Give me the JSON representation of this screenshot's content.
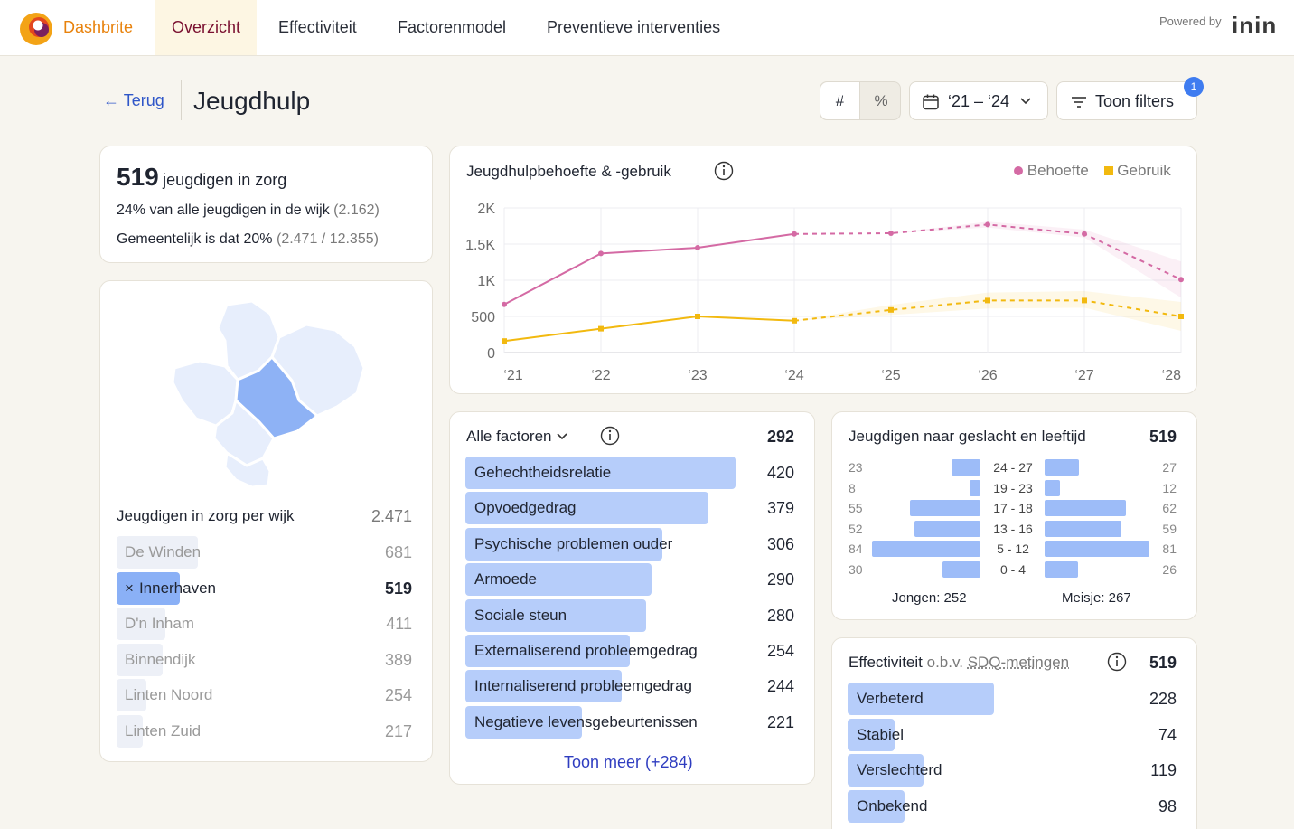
{
  "app": {
    "brand": "Dashbrite",
    "powered_by": "Powered by",
    "partner": "inin"
  },
  "nav": [
    {
      "label": "Overzicht",
      "active": true
    },
    {
      "label": "Effectiviteit",
      "active": false
    },
    {
      "label": "Factorenmodel",
      "active": false
    },
    {
      "label": "Preventieve interventies",
      "active": false
    }
  ],
  "header": {
    "back_label": "Terug",
    "title": "Jeugdhulp",
    "toggle": [
      "#",
      "%"
    ],
    "date_range": "‘21 – ‘24",
    "filters_label": "Toon filters",
    "filters_count": "1"
  },
  "summary": {
    "count": "519",
    "count_label": "jeugdigen in zorg",
    "line1_text": "24% van alle jeugdigen in de wijk",
    "line1_muted": "(2.162)",
    "line2_text": "Gemeentelijk is dat 20%",
    "line2_muted": "(2.471 / 12.355)"
  },
  "wijk": {
    "title": "Jeugdigen in zorg per wijk",
    "total": "2.471",
    "items": [
      {
        "label": "De Winden",
        "value": "681",
        "fraction": 1.0,
        "selected": false
      },
      {
        "label": "Innerhaven",
        "value": "519",
        "fraction": 0.76,
        "selected": true,
        "remove_glyph": "×"
      },
      {
        "label": "D'n Inham",
        "value": "411",
        "fraction": 0.6,
        "selected": false
      },
      {
        "label": "Binnendijk",
        "value": "389",
        "fraction": 0.57,
        "selected": false
      },
      {
        "label": "Linten Noord",
        "value": "254",
        "fraction": 0.37,
        "selected": false
      },
      {
        "label": "Linten Zuid",
        "value": "217",
        "fraction": 0.32,
        "selected": false
      }
    ]
  },
  "chart_data": {
    "type": "line",
    "title": "Jeugdhulpbehoefte & -gebruik",
    "legend_position": "top-right",
    "grid": true,
    "x": [
      "‘21",
      "‘22",
      "‘23",
      "‘24",
      "‘25",
      "‘26",
      "‘27",
      "‘28"
    ],
    "yticks": [
      "0",
      "500",
      "1K",
      "1.5K",
      "2K"
    ],
    "ylim": [
      0,
      2000
    ],
    "series": [
      {
        "name": "Behoefte",
        "color": "#d46aa4",
        "values": [
          665,
          1370,
          1450,
          1640,
          1650,
          1770,
          1640,
          1010
        ],
        "forecast_from": 3,
        "band": [
          [
            1650,
            1650
          ],
          [
            1730,
            1810
          ],
          [
            1590,
            1700
          ],
          [
            760,
            1260
          ]
        ]
      },
      {
        "name": "Gebruik",
        "color": "#f2b90f",
        "values": [
          160,
          330,
          500,
          440,
          590,
          720,
          720,
          500
        ],
        "forecast_from": 3,
        "band": [
          [
            520,
            660
          ],
          [
            610,
            830
          ],
          [
            620,
            850
          ],
          [
            300,
            700
          ]
        ]
      }
    ]
  },
  "factors": {
    "title": "Alle factoren",
    "total": "292",
    "items": [
      {
        "label": "Gehechtheidsrelatie",
        "value": "420",
        "fraction": 1.0
      },
      {
        "label": "Opvoedgedrag",
        "value": "379",
        "fraction": 0.9
      },
      {
        "label": "Psychische problemen ouder",
        "value": "306",
        "fraction": 0.73
      },
      {
        "label": "Armoede",
        "value": "290",
        "fraction": 0.69
      },
      {
        "label": "Sociale steun",
        "value": "280",
        "fraction": 0.67
      },
      {
        "label": "Externaliserend probleemgedrag",
        "value": "254",
        "fraction": 0.61
      },
      {
        "label": "Internaliserend probleemgedrag",
        "value": "244",
        "fraction": 0.58
      },
      {
        "label": "Negatieve levensgebeurtenissen",
        "value": "221",
        "fraction": 0.43
      }
    ],
    "more_label": "Toon meer (+284)"
  },
  "pyramid": {
    "title": "Jeugdigen naar geslacht en leeftijd",
    "total": "519",
    "rows": [
      {
        "age": "24 - 27",
        "boys": "23",
        "girls": "27",
        "boys_frac": 0.27,
        "girls_frac": 0.33
      },
      {
        "age": "19 - 23",
        "boys": "8",
        "girls": "12",
        "boys_frac": 0.1,
        "girls_frac": 0.15
      },
      {
        "age": "17 - 18",
        "boys": "55",
        "girls": "62",
        "boys_frac": 0.65,
        "girls_frac": 0.77
      },
      {
        "age": "13 - 16",
        "boys": "52",
        "girls": "59",
        "boys_frac": 0.61,
        "girls_frac": 0.73
      },
      {
        "age": "5 - 12",
        "boys": "84",
        "girls": "81",
        "boys_frac": 1.0,
        "girls_frac": 1.0
      },
      {
        "age": "0 - 4",
        "boys": "30",
        "girls": "26",
        "boys_frac": 0.35,
        "girls_frac": 0.32
      }
    ],
    "boys_label": "Jongen: 252",
    "girls_label": "Meisje: 267"
  },
  "effect": {
    "title": "Effectiviteit",
    "title_muted": "o.b.v.",
    "title_link": "SDQ-metingen",
    "total": "519",
    "items": [
      {
        "label": "Verbeterd",
        "value": "228",
        "fraction": 1.0
      },
      {
        "label": "Stabiel",
        "value": "74",
        "fraction": 0.32
      },
      {
        "label": "Verslechterd",
        "value": "119",
        "fraction": 0.52
      },
      {
        "label": "Onbekend",
        "value": "98",
        "fraction": 0.39
      }
    ]
  }
}
